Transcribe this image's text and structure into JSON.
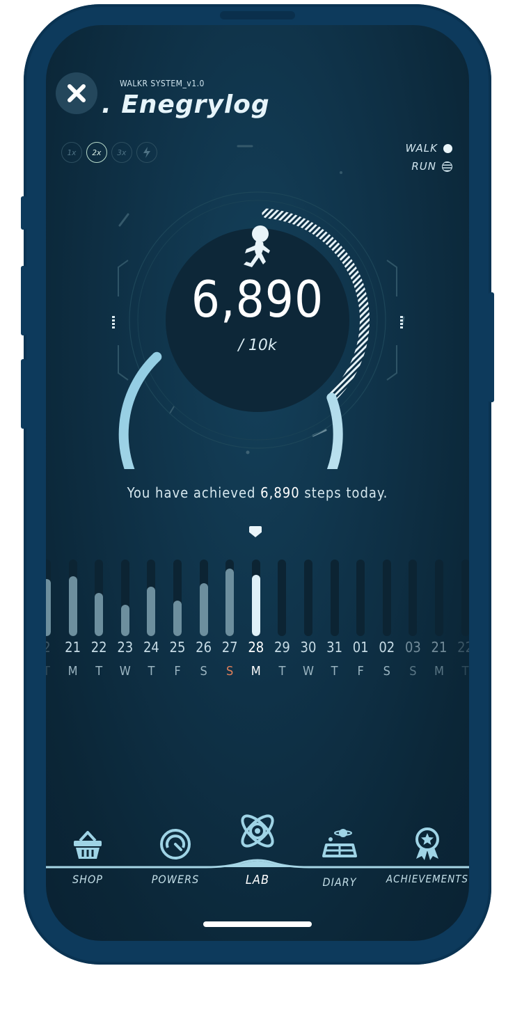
{
  "header": {
    "system_label": "WALKR SYSTEM_v1.0",
    "title": ". Enegrylog"
  },
  "multipliers": [
    "1x",
    "2x",
    "3x"
  ],
  "modes": {
    "walk": "WALK",
    "run": "RUN"
  },
  "ring": {
    "steps": "6,890",
    "goal": "/ 10k",
    "progress": 0.689
  },
  "summary": {
    "prefix": "You have achieved ",
    "steps": "6,890",
    "suffix": " steps today."
  },
  "week": {
    "dates": [
      "2",
      "21",
      "22",
      "23",
      "24",
      "25",
      "26",
      "27",
      "28",
      "29",
      "30",
      "31",
      "01",
      "02",
      "03",
      "21",
      "22"
    ],
    "days": [
      "T",
      "M",
      "T",
      "W",
      "T",
      "F",
      "S",
      "S",
      "M",
      "T",
      "W",
      "T",
      "F",
      "S",
      "S",
      "M",
      "T"
    ],
    "levels": [
      0.75,
      0.78,
      0.56,
      0.41,
      0.65,
      0.46,
      0.69,
      0.88,
      0.8,
      0,
      0,
      0,
      0,
      0,
      0,
      0,
      0
    ]
  },
  "nav": {
    "shop": "SHOP",
    "powers": "POWERS",
    "lab": "LAB",
    "diary": "DIARY",
    "achievements": "ACHIEVEMENTS"
  },
  "colors": {
    "background": "#0f3248",
    "accent": "#9fd4e6",
    "sunday": "#e0805a",
    "frame": "#0d3a5c"
  }
}
